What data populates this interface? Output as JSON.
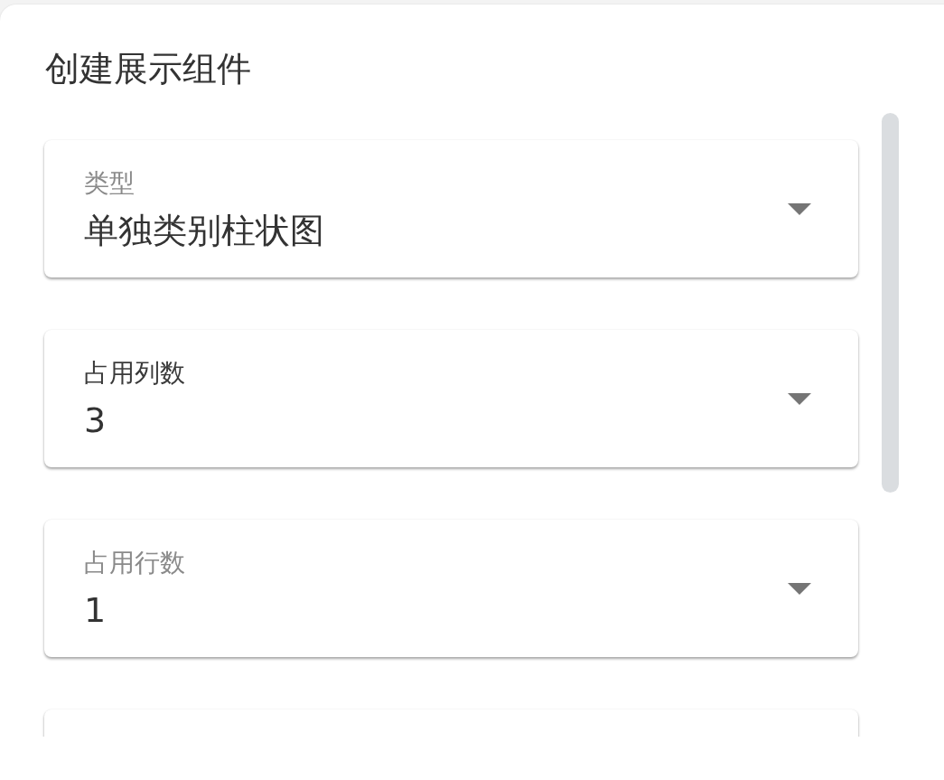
{
  "dialog": {
    "title": "创建展示组件"
  },
  "fields": [
    {
      "kind": "select",
      "label": "类型",
      "value": "单独类别柱状图",
      "focused": false
    },
    {
      "kind": "select",
      "label": "占用列数",
      "value": "3",
      "focused": true
    },
    {
      "kind": "select",
      "label": "占用行数",
      "value": "1",
      "focused": false
    },
    {
      "kind": "clipped"
    }
  ]
}
